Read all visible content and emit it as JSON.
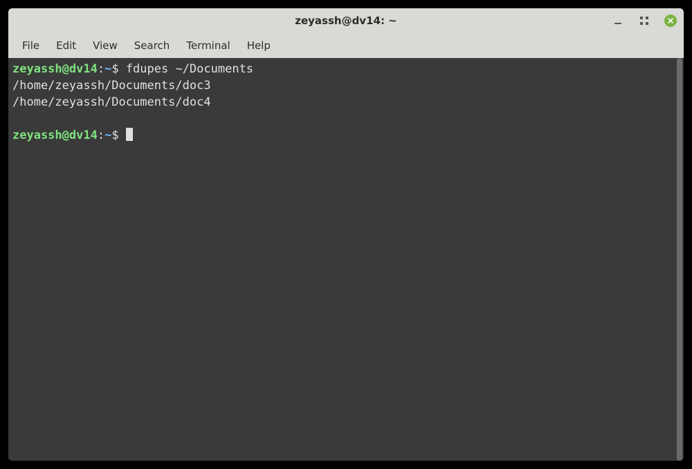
{
  "window": {
    "title": "zeyassh@dv14: ~"
  },
  "menu": {
    "file": "File",
    "edit": "Edit",
    "view": "View",
    "search": "Search",
    "terminal": "Terminal",
    "help": "Help"
  },
  "prompt": {
    "userhost": "zeyassh@dv14",
    "separator": ":",
    "path": "~",
    "dollar": "$"
  },
  "session": {
    "command1": " fdupes ~/Documents",
    "output_line1": "/home/zeyassh/Documents/doc3",
    "output_line2": "/home/zeyassh/Documents/doc4",
    "blank": "",
    "command2": " "
  }
}
